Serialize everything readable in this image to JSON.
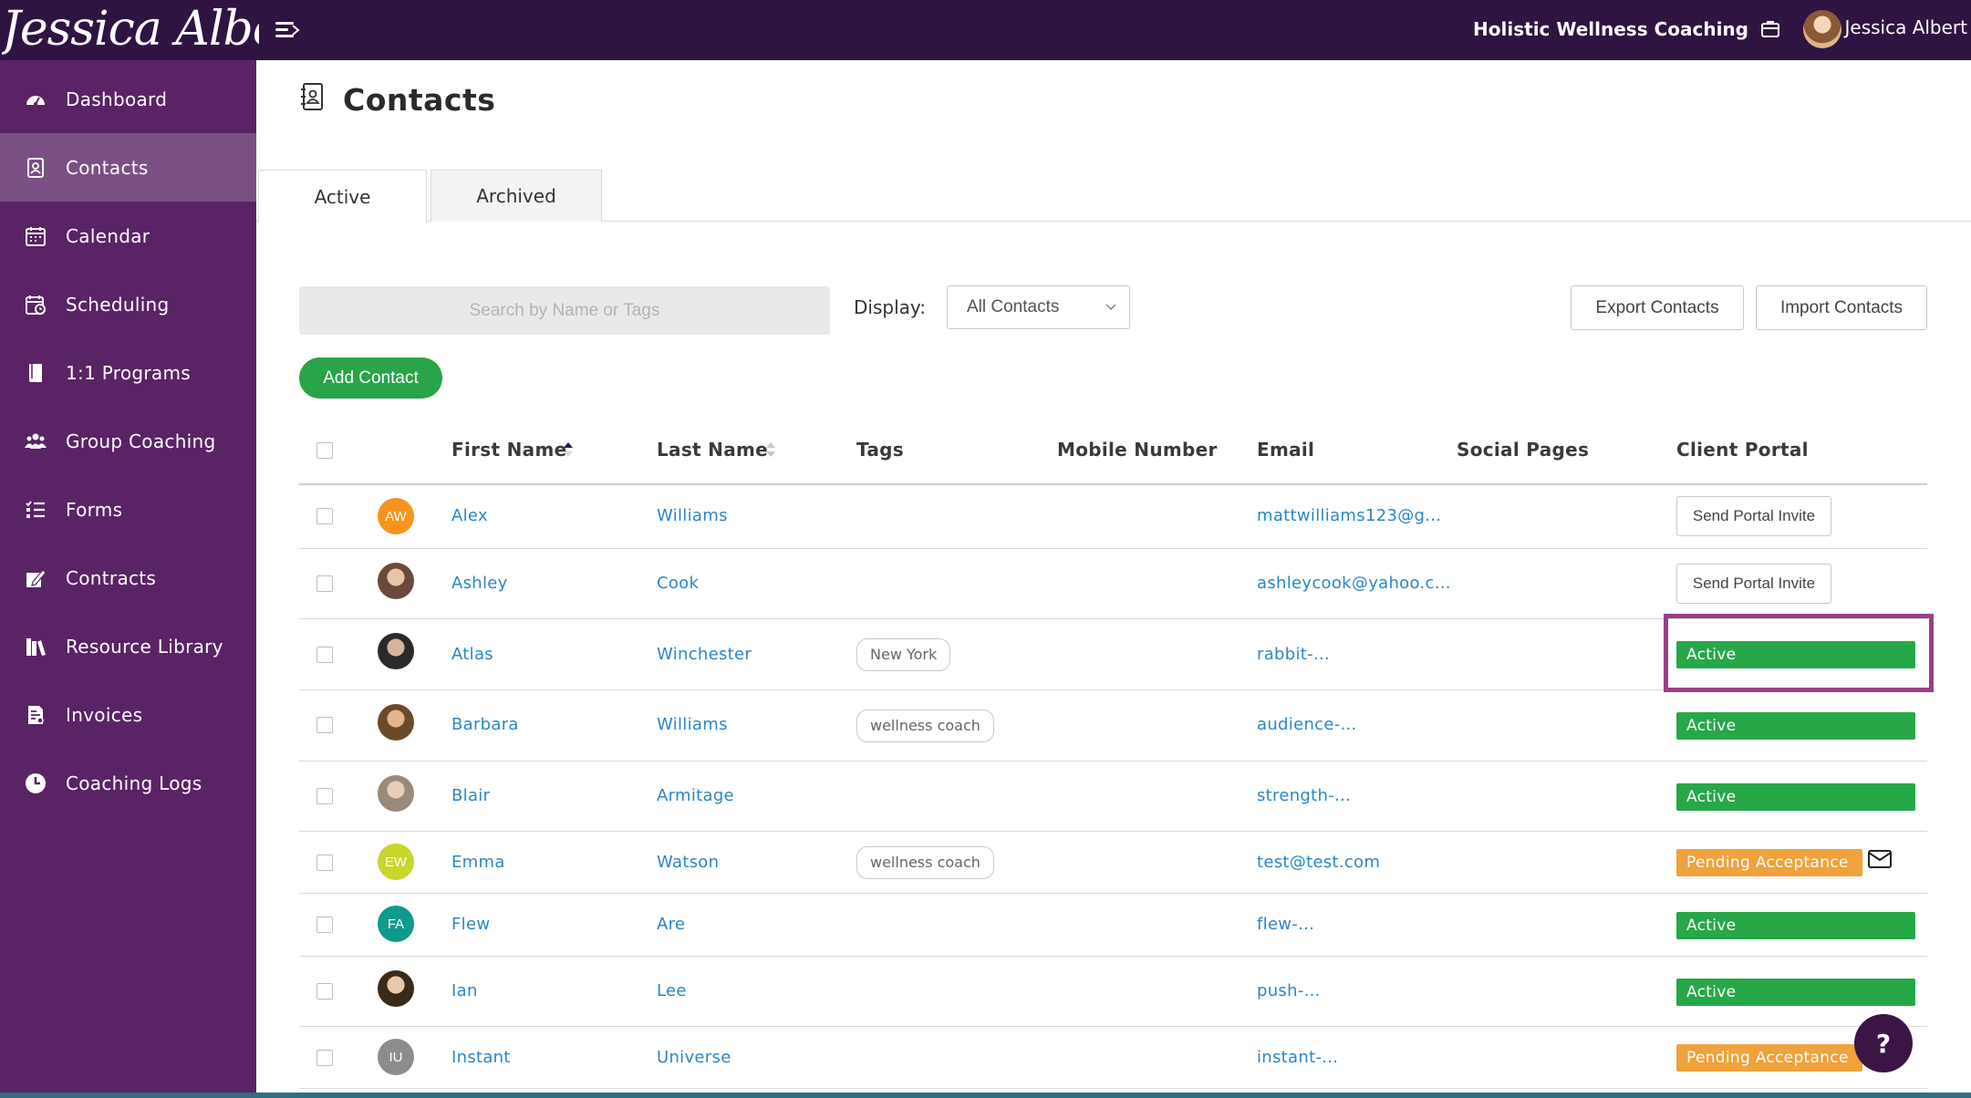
{
  "brand": {
    "logo_text": "Jessica Albert"
  },
  "header": {
    "org_name": "Holistic Wellness Coaching",
    "user_name": "Jessica Albert"
  },
  "sidebar": {
    "items": [
      {
        "label": "Dashboard",
        "icon": "dashboard-icon"
      },
      {
        "label": "Contacts",
        "icon": "contacts-icon",
        "active": true
      },
      {
        "label": "Calendar",
        "icon": "calendar-icon"
      },
      {
        "label": "Scheduling",
        "icon": "scheduling-icon"
      },
      {
        "label": "1:1 Programs",
        "icon": "book-icon"
      },
      {
        "label": "Group Coaching",
        "icon": "group-icon"
      },
      {
        "label": "Forms",
        "icon": "forms-list-icon"
      },
      {
        "label": "Contracts",
        "icon": "contract-sign-icon"
      },
      {
        "label": "Resource Library",
        "icon": "library-icon"
      },
      {
        "label": "Invoices",
        "icon": "invoice-icon"
      },
      {
        "label": "Coaching Logs",
        "icon": "clock-icon"
      }
    ]
  },
  "page": {
    "title": "Contacts"
  },
  "tabs": [
    {
      "label": "Active"
    },
    {
      "label": "Archived"
    }
  ],
  "toolbar": {
    "search_placeholder": "Search by Name or Tags",
    "display_label": "Display:",
    "display_value": "All Contacts",
    "export_label": "Export Contacts",
    "import_label": "Import Contacts",
    "add_label": "Add Contact"
  },
  "table": {
    "columns": [
      "First Name",
      "Last Name",
      "Tags",
      "Mobile Number",
      "Email",
      "Social Pages",
      "Client Portal"
    ],
    "rows": [
      {
        "first": "Alex",
        "last": "Williams",
        "initials": "AW",
        "avatar_color": "#f7941d",
        "tag": "",
        "email": "mattwilliams123@g...",
        "portal": "Send Portal Invite",
        "portal_type": "invite"
      },
      {
        "first": "Ashley",
        "last": "Cook",
        "initials": "",
        "avatar_color": "#b08a72",
        "tag": "",
        "email": "ashleycook@yahoo.c...",
        "portal": "Send Portal Invite",
        "portal_type": "invite"
      },
      {
        "first": "Atlas",
        "last": "Winchester",
        "initials": "",
        "avatar_color": "#4a4a4a",
        "tag": "New York",
        "email": "rabbit-...",
        "portal": "Active",
        "portal_type": "active"
      },
      {
        "first": "Barbara",
        "last": "Williams",
        "initials": "",
        "avatar_color": "#7a5a3a",
        "tag": "wellness coach",
        "email": "audience-...",
        "portal": "Active",
        "portal_type": "active"
      },
      {
        "first": "Blair",
        "last": "Armitage",
        "initials": "",
        "avatar_color": "#9a8a7a",
        "tag": "",
        "email": "strength-...",
        "portal": "Active",
        "portal_type": "active"
      },
      {
        "first": "Emma",
        "last": "Watson",
        "initials": "EW",
        "avatar_color": "#c8d62c",
        "tag": "wellness coach",
        "email": "test@test.com",
        "portal": "Pending Acceptance",
        "portal_type": "pending"
      },
      {
        "first": "Flew",
        "last": "Are",
        "initials": "FA",
        "avatar_color": "#0e9a8c",
        "tag": "",
        "email": "flew-...",
        "portal": "Active",
        "portal_type": "active"
      },
      {
        "first": "Ian",
        "last": "Lee",
        "initials": "",
        "avatar_color": "#5a3a2a",
        "tag": "",
        "email": "push-...",
        "portal": "Active",
        "portal_type": "active"
      },
      {
        "first": "Instant",
        "last": "Universe",
        "initials": "IU",
        "avatar_color": "#8c8c8c",
        "tag": "",
        "email": "instant-...",
        "portal": "Pending Acceptance",
        "portal_type": "pending"
      }
    ]
  },
  "help": {
    "label": "?"
  },
  "colors": {
    "topbar": "#2f1442",
    "sidebar": "#5a2366",
    "accent_green": "#26a849",
    "pending_orange": "#f0a23b",
    "link_blue": "#2a86c9",
    "highlight": "#9b3f86"
  }
}
